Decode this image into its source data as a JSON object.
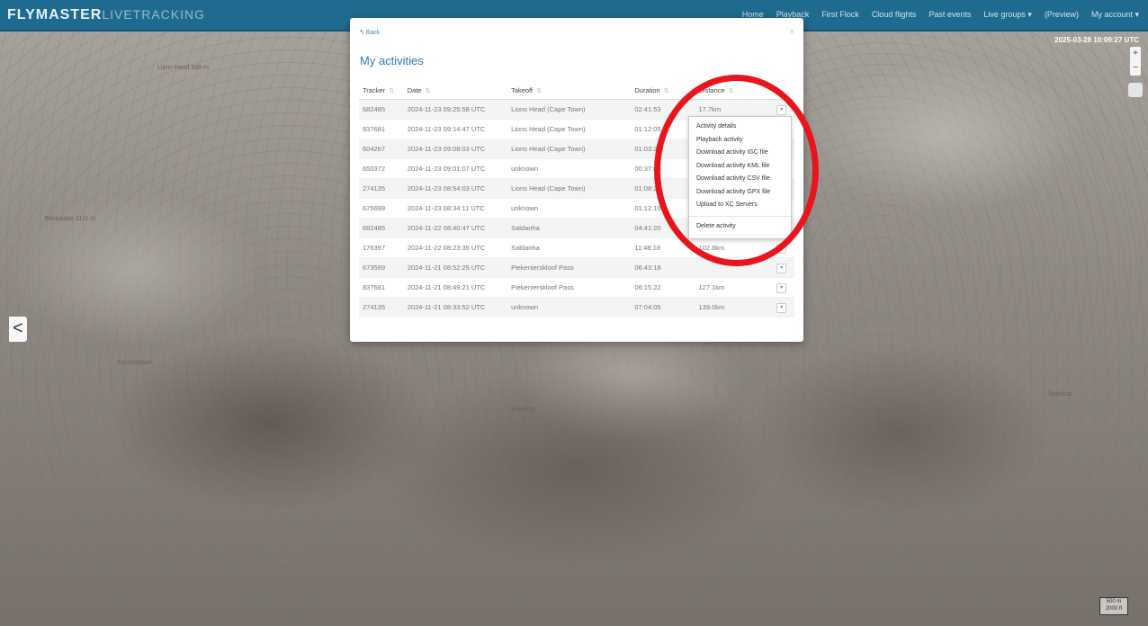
{
  "app": {
    "brand_main": "FLYMASTER",
    "brand_sub": "LIVETRACKING",
    "nav": [
      "Home",
      "Playback",
      "First Flock",
      "Cloud flights",
      "Past events",
      "Live groups ▾",
      "(Preview)",
      "My account ▾"
    ],
    "timestamp": "2025-03-28 10:09:27 UTC"
  },
  "map": {
    "labels": [
      "Lions Head 669 m",
      "Kasteelpoort",
      "Blinkwater 1111 m",
      "Kloofkop",
      "Spitzkop"
    ],
    "scale": [
      "500 m",
      "2000 ft"
    ],
    "zoom_in": "+",
    "zoom_out": "−",
    "side_toggle": "<"
  },
  "modal": {
    "back_label": "↰ Back",
    "close": "×",
    "title": "My activities",
    "columns": [
      "Tracker",
      "Date",
      "Takeoff",
      "Duration",
      "Distance"
    ],
    "rows": [
      {
        "tracker": "682485",
        "date": "2024-11-23 09:25:58 UTC",
        "takeoff": "Lions Head (Cape Town)",
        "duration": "02:41:53",
        "distance": "17.7km"
      },
      {
        "tracker": "837681",
        "date": "2024-11-23 09:14:47 UTC",
        "takeoff": "Lions Head (Cape Town)",
        "duration": "01:12:05",
        "distance": ""
      },
      {
        "tracker": "604267",
        "date": "2024-11-23 09:08:03 UTC",
        "takeoff": "Lions Head (Cape Town)",
        "duration": "01:03:23",
        "distance": ""
      },
      {
        "tracker": "650372",
        "date": "2024-11-23 09:01:07 UTC",
        "takeoff": "unknown",
        "duration": "00:37:09",
        "distance": ""
      },
      {
        "tracker": "274135",
        "date": "2024-11-23 08:54:03 UTC",
        "takeoff": "Lions Head (Cape Town)",
        "duration": "01:08:29",
        "distance": ""
      },
      {
        "tracker": "675699",
        "date": "2024-11-23 08:34:11 UTC",
        "takeoff": "unknown",
        "duration": "01:12:10",
        "distance": ""
      },
      {
        "tracker": "682485",
        "date": "2024-11-22 08:40:47 UTC",
        "takeoff": "Saldanha",
        "duration": "04:41:20",
        "distance": ""
      },
      {
        "tracker": "176397",
        "date": "2024-11-22 08:23:35 UTC",
        "takeoff": "Saldanha",
        "duration": "11:48:18",
        "distance": "102.8km"
      },
      {
        "tracker": "673599",
        "date": "2024-11-21 08:52:25 UTC",
        "takeoff": "Piekenierskloof Pass",
        "duration": "06:43:18",
        "distance": ""
      },
      {
        "tracker": "837681",
        "date": "2024-11-21 08:49:21 UTC",
        "takeoff": "Piekenierskloof Pass",
        "duration": "06:15:22",
        "distance": "127.1km"
      },
      {
        "tracker": "274135",
        "date": "2024-11-21 08:33:52 UTC",
        "takeoff": "unknown",
        "duration": "07:04:05",
        "distance": "139.0km"
      }
    ],
    "row_button": "▾"
  },
  "dropdown": {
    "items": [
      "Activity details",
      "Playback activity",
      "Download activity IGC file",
      "Download activity KML file",
      "Download activity CSV file",
      "Download activity GPX file",
      "Upload to XC Servers"
    ],
    "delete": "Delete activity"
  },
  "colors": {
    "navbar": "#1f6b8f",
    "link": "#2a7cb3",
    "annotation": "#e8151d"
  }
}
